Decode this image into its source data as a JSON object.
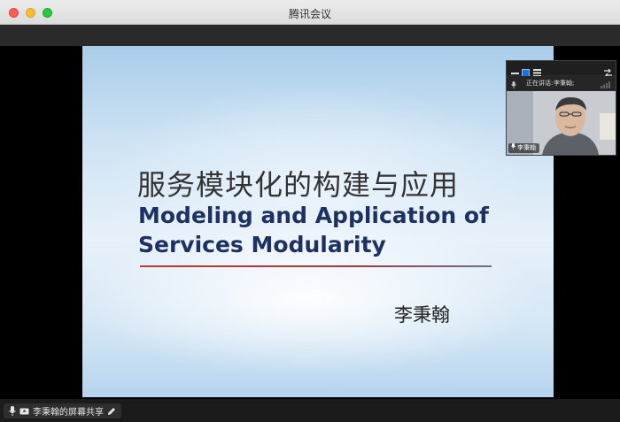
{
  "window": {
    "title": "腾讯会议"
  },
  "slide": {
    "title_cn": "服务模块化的构建与应用",
    "title_en_line1": "Modeling and Application of",
    "title_en_line2": "Services Modularity",
    "author": "李秉翰"
  },
  "video_panel": {
    "speaking_label": "正在讲话:",
    "speaking_name": "李秉翰;",
    "participant_name": "李秉翰",
    "icons": [
      "minimize-icon",
      "gallery-icon",
      "list-icon",
      "expand-icon",
      "mic-icon",
      "signal-icon"
    ]
  },
  "bottom_bar": {
    "share_label": "李秉翰的屏幕共享",
    "icons": [
      "mic-icon",
      "screen-share-icon",
      "pencil-icon"
    ]
  }
}
